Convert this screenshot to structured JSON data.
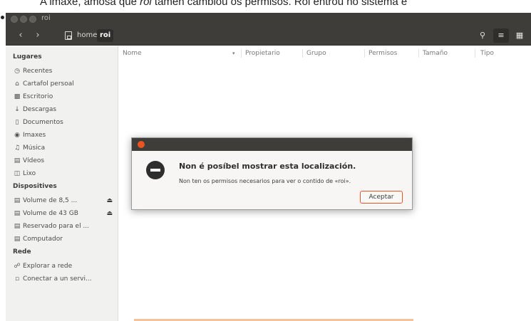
{
  "caption": {
    "prefix": "A imaxe, amosa que ",
    "user": "roi",
    "suffix": " tamén cambiou os permisos. Roi entrou no sistema e"
  },
  "window": {
    "title": "roi"
  },
  "toolbar": {
    "back_icon": "chevron-left-icon",
    "forward_icon": "chevron-right-icon",
    "breadcrumbs": [
      "home",
      "roi"
    ],
    "search_icon": "search-icon",
    "list_view_icon": "list-view-icon",
    "grid_view_icon": "grid-view-icon"
  },
  "sidebar": {
    "sections": [
      {
        "title": "Lugares",
        "items": [
          {
            "label": "Recentes",
            "icon": "clock-icon"
          },
          {
            "label": "Cartafol persoal",
            "icon": "home-icon"
          },
          {
            "label": "Escritorio",
            "icon": "desktop-icon"
          },
          {
            "label": "Descargas",
            "icon": "download-icon"
          },
          {
            "label": "Documentos",
            "icon": "document-icon"
          },
          {
            "label": "Imaxes",
            "icon": "camera-icon"
          },
          {
            "label": "Música",
            "icon": "music-icon"
          },
          {
            "label": "Vídeos",
            "icon": "film-icon"
          },
          {
            "label": "Lixo",
            "icon": "trash-icon"
          }
        ]
      },
      {
        "title": "Dispositives",
        "items": [
          {
            "label": "Volume de 8,5 ...",
            "icon": "drive-icon",
            "eject": true
          },
          {
            "label": "Volume de 43 GB",
            "icon": "drive-icon",
            "eject": true
          },
          {
            "label": "Reservado para el ...",
            "icon": "drive-icon",
            "eject": false
          },
          {
            "label": "Computador",
            "icon": "drive-icon",
            "eject": false
          }
        ]
      },
      {
        "title": "Rede",
        "items": [
          {
            "label": "Explorar a rede",
            "icon": "network-icon"
          },
          {
            "label": "Conectar a un servi...",
            "icon": "server-icon"
          }
        ]
      }
    ]
  },
  "columns": [
    "Nome",
    "Propietario",
    "Grupo",
    "Permisos",
    "Tamaño",
    "Tipo"
  ],
  "dialog": {
    "heading": "Non é posíbel mostrar esta localización.",
    "message": "Non ten os permisos necesarios para ver o contido de «roi».",
    "button": "Aceptar"
  },
  "colors": {
    "titlebar": "#3e3d39",
    "accent": "#e95420",
    "sidebar": "#f1f1f0"
  }
}
